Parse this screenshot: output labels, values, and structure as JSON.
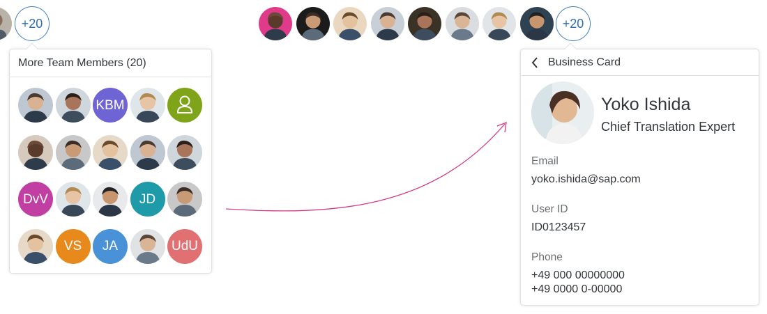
{
  "left_group": {
    "more_label": "+20"
  },
  "right_group": {
    "avatars": [
      {
        "name": "team-member-1"
      },
      {
        "name": "team-member-2"
      },
      {
        "name": "team-member-3"
      },
      {
        "name": "team-member-4"
      },
      {
        "name": "team-member-5"
      },
      {
        "name": "team-member-6"
      },
      {
        "name": "team-member-7"
      },
      {
        "name": "team-member-8"
      }
    ],
    "more_label": "+20"
  },
  "team_popover": {
    "title": "More Team Members (20)",
    "members": [
      {
        "kind": "photo"
      },
      {
        "kind": "photo"
      },
      {
        "kind": "initials",
        "text": "KBM",
        "color": "#6e64d4"
      },
      {
        "kind": "photo"
      },
      {
        "kind": "icon",
        "icon": "person-icon",
        "color": "#7fa419"
      },
      {
        "kind": "photo"
      },
      {
        "kind": "photo"
      },
      {
        "kind": "photo"
      },
      {
        "kind": "photo"
      },
      {
        "kind": "photo"
      },
      {
        "kind": "initials",
        "text": "DvV",
        "color": "#c13ea2"
      },
      {
        "kind": "photo"
      },
      {
        "kind": "photo"
      },
      {
        "kind": "initials",
        "text": "JD",
        "color": "#1e9aa9"
      },
      {
        "kind": "photo"
      },
      {
        "kind": "photo"
      },
      {
        "kind": "initials",
        "text": "VS",
        "color": "#e8891b"
      },
      {
        "kind": "initials",
        "text": "JA",
        "color": "#4a92d8"
      },
      {
        "kind": "photo"
      },
      {
        "kind": "initials",
        "text": "UdU",
        "color": "#e07072"
      }
    ]
  },
  "business_card": {
    "back_icon": "chevron-left-icon",
    "title": "Business Card",
    "name": "Yoko Ishida",
    "job_title": "Chief Translation Expert",
    "email_label": "Email",
    "email": "yoko.ishida@sap.com",
    "user_id_label": "User ID",
    "user_id": "ID0123457",
    "phone_label": "Phone",
    "phone_1": "+49 000 00000000",
    "phone_2": "+49 0000 0-00000"
  },
  "colors": {
    "accent": "#3f7fc1",
    "connector": "#d33a86",
    "border": "#e1e1e1"
  }
}
